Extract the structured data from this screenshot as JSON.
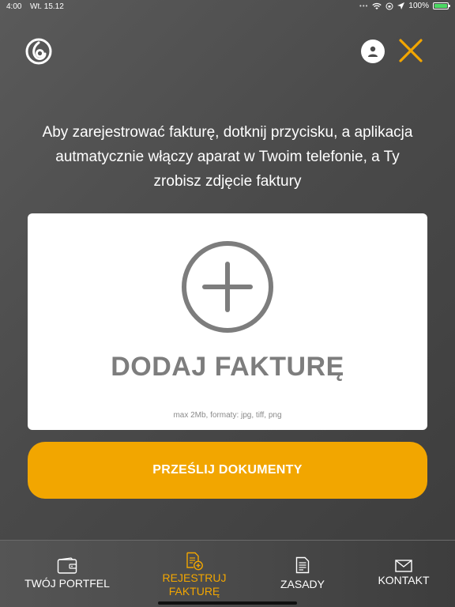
{
  "status_bar": {
    "time": "4:00",
    "date": "Wt. 15.12",
    "battery": "100%",
    "icons": [
      "wifi-icon",
      "rotation-lock-icon",
      "location-icon",
      "battery-icon"
    ]
  },
  "header": {
    "logo_icon": "brand-logo-icon",
    "user_icon": "user-icon",
    "close_icon": "close-icon"
  },
  "instructions": {
    "text": "Aby zarejestrować fakturę, dotknij przycisku, a aplikacja autmatycznie włączy aparat w Twoim telefonie, a Ty zrobisz zdjęcie faktury"
  },
  "upload_card": {
    "icon": "plus-circle-icon",
    "title": "DODAJ FAKTURĘ",
    "note": "max 2Mb, formaty: jpg, tiff, png"
  },
  "submit_button": {
    "label": "PRZEŚLIJ DOKUMENTY"
  },
  "tabs": [
    {
      "label": "TWÓJ PORTFEL",
      "icon": "wallet-icon",
      "active": false
    },
    {
      "label_line1": "REJESTRUJ",
      "label_line2": "FAKTURĘ",
      "icon": "add-document-icon",
      "active": true
    },
    {
      "label": "ZASADY",
      "icon": "document-icon",
      "active": false
    },
    {
      "label": "KONTAKT",
      "icon": "envelope-icon",
      "active": false
    }
  ],
  "colors": {
    "accent": "#f2a600",
    "background": "#4a4a4a",
    "card": "#ffffff",
    "card_text": "#7d7d7d"
  }
}
